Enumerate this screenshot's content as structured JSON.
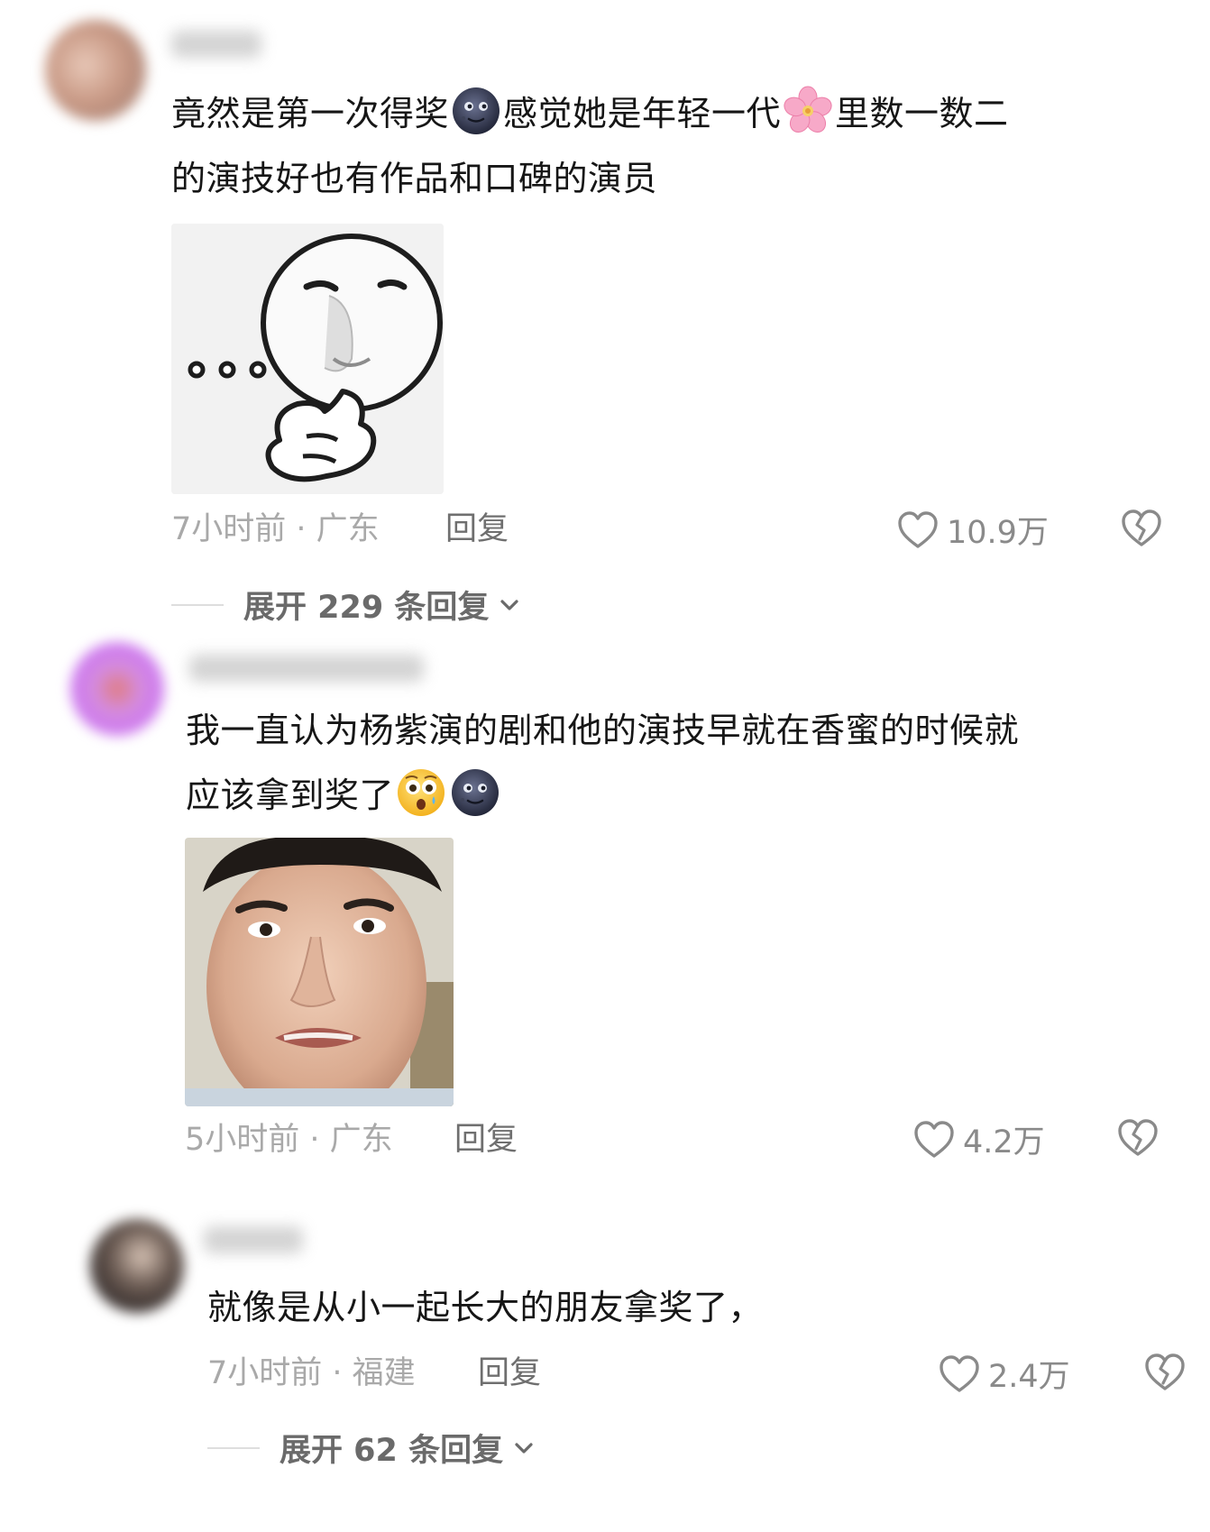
{
  "comments": [
    {
      "text_line1": "竟然是第一次得奖",
      "text_line1_mid": "感觉她是年轻一代",
      "text_line1_end": "里数一数二",
      "text_line2": "的演技好也有作品和口碑的演员",
      "emoji_1": "dark-moon-face",
      "emoji_2": "cherry-blossom",
      "meme": "thinking-face-sticker",
      "time": "7小时前 · 广东",
      "reply_label": "回复",
      "likes": "10.9万",
      "expand_label": "展开 229 条回复"
    },
    {
      "text_line1": "我一直认为杨紫演的剧和他的演技早就在香蜜的时候就",
      "text_line2": "应该拿到奖了",
      "emoji_1": "astonished-face",
      "emoji_2": "dark-moon-face",
      "meme": "confused-man-photo",
      "time": "5小时前 · 广东",
      "reply_label": "回复",
      "likes": "4.2万"
    },
    {
      "text_line1": "就像是从小一起长大的朋友拿奖了，",
      "time": "7小时前 · 福建",
      "reply_label": "回复",
      "likes": "2.4万",
      "expand_label": "展开 62 条回复"
    }
  ],
  "colors": {
    "meta_gray": "#a9a9a9",
    "reply_gray": "#6f6f6f",
    "text": "#161616"
  }
}
